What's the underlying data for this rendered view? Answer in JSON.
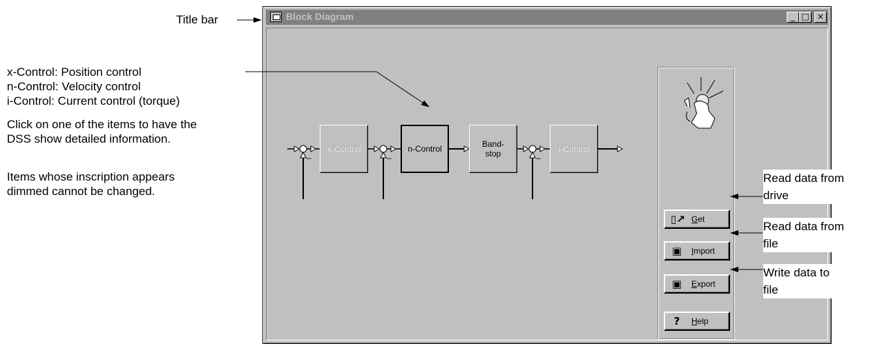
{
  "annotations": {
    "title_bar_label": "Title bar",
    "control_desc": [
      "x-Control: Position control",
      "n-Control: Velocity control",
      "i-Control:  Current control (torque)"
    ],
    "click_hint": [
      "Click on one of the items to have the",
      "DSS show detailed information."
    ],
    "dimmed_hint": [
      "Items whose inscription appears",
      "dimmed cannot be changed."
    ],
    "get_callout": [
      "Read data from",
      "drive"
    ],
    "import_callout": [
      "Read data from",
      "file"
    ],
    "export_callout": [
      "Write data to",
      "file"
    ]
  },
  "window": {
    "title": "Block Diagram",
    "minimize": "_",
    "maximize": "□",
    "close": "×"
  },
  "blocks": {
    "x_control": {
      "label": "x-Control",
      "dimmed": true
    },
    "n_control": {
      "label": "n-Control",
      "dimmed": false
    },
    "bandstop": {
      "label_line1": "Band-",
      "label_line2": "stop",
      "dimmed": false
    },
    "i_control": {
      "label": "i-Control",
      "dimmed": true
    }
  },
  "summing_minus": "–",
  "buttons": {
    "get": {
      "label": "Get",
      "icon": "drive-read-icon"
    },
    "import": {
      "label": "Import",
      "icon": "floppy-disk-icon"
    },
    "export": {
      "label": "Export",
      "icon": "floppy-disk-save-icon"
    },
    "help": {
      "label": "Help",
      "icon": "question-mark-icon"
    }
  },
  "colors": {
    "window_bg": "#c0c0c0",
    "inactive_title": "#808080"
  }
}
